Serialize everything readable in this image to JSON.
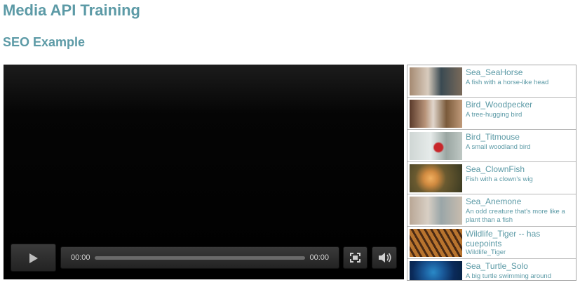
{
  "page": {
    "title": "Media API Training",
    "subtitle": "SEO Example"
  },
  "player": {
    "current_time": "00:00",
    "duration": "00:00",
    "progress": 0
  },
  "playlist": {
    "items": [
      {
        "title": "Sea_SeaHorse",
        "desc": "A fish with a horse-like head",
        "thumb": "seahorse-thumbnail"
      },
      {
        "title": "Bird_Woodpecker",
        "desc": "A tree-hugging bird",
        "thumb": "woodpecker-thumbnail"
      },
      {
        "title": "Bird_Titmouse",
        "desc": "A small woodland bird",
        "thumb": "titmouse-thumbnail"
      },
      {
        "title": "Sea_ClownFish",
        "desc": "Fish with a clown's wig",
        "thumb": "clownfish-thumbnail"
      },
      {
        "title": "Sea_Anemone",
        "desc": "An odd creature that's more like a plant than a fish",
        "thumb": "anemone-thumbnail"
      },
      {
        "title": "Wildlife_Tiger -- has cuepoints",
        "desc": "Wildlife_Tiger",
        "thumb": "tiger-thumbnail"
      },
      {
        "title": "Sea_Turtle_Solo",
        "desc": "A big turtle swimming around",
        "thumb": "turtle-thumbnail"
      }
    ]
  },
  "colors": {
    "heading": "#5c9aa6",
    "player_bg": "#000000",
    "control_bg": "#2c2c2c"
  }
}
